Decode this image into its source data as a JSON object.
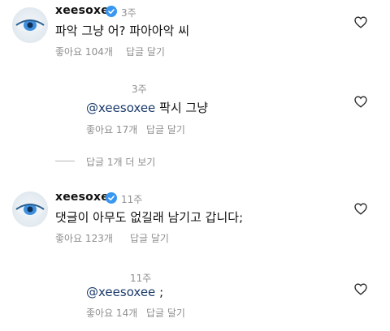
{
  "comments": [
    {
      "username": "xeesoxee",
      "time": "3주",
      "text": "파악 그냥 어? 파아아악 씨",
      "likes": "좋아요 104개",
      "reply": "답글 달기"
    },
    {
      "time": "3주",
      "mention": "@xeesoxee",
      "text": "팍시 그냥",
      "likes": "좋아요 17개",
      "reply": "답글 달기"
    },
    {
      "username": "xeesoxee",
      "time": "11주",
      "text": "댓글이 아무도 없길래 남기고 갑니다;",
      "likes": "좋아요 123개",
      "reply": "답글 달기"
    },
    {
      "time": "11주",
      "mention": "@xeesoxee",
      "text": ";",
      "likes": "좋아요 14개",
      "reply": "답글 달기"
    }
  ],
  "view_more": "답글 1개 더 보기"
}
